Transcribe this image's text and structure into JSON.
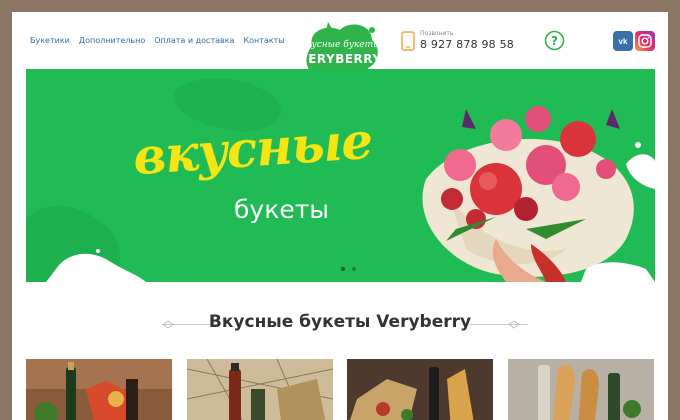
{
  "nav": {
    "items": [
      "Букетики",
      "Дополнительно",
      "Оплата и доставка",
      "Контакты"
    ]
  },
  "logo": {
    "top_text": "Вкусные букеты",
    "brand": "VERYBERRY"
  },
  "contact": {
    "label": "Позвонить",
    "phone": "8 927 878 98 58"
  },
  "social": {
    "vk": "vk",
    "icons": [
      "vk-icon",
      "instagram-icon",
      "help-icon",
      "phone-icon"
    ]
  },
  "banner": {
    "headline": "вкусные",
    "subheadline": "букеты",
    "slides": 2,
    "active_slide": 0,
    "colors": {
      "background": "#21bb55",
      "headline": "#f5e514"
    }
  },
  "section": {
    "title": "Вкусные букеты Veryberry"
  },
  "products": [
    {
      "name": "product-tile-1"
    },
    {
      "name": "product-tile-2"
    },
    {
      "name": "product-tile-3"
    },
    {
      "name": "product-tile-4"
    }
  ]
}
